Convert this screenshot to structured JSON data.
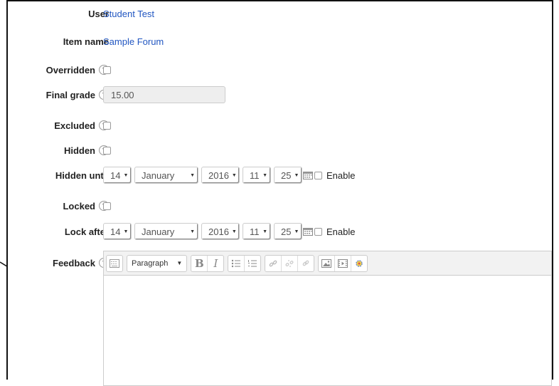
{
  "form": {
    "user": {
      "label": "User",
      "value": "Student Test"
    },
    "item_name": {
      "label": "Item name",
      "value": "Sample Forum"
    },
    "overridden": {
      "label": "Overridden"
    },
    "final_grade": {
      "label": "Final grade",
      "value": "15.00"
    },
    "excluded": {
      "label": "Excluded"
    },
    "hidden": {
      "label": "Hidden"
    },
    "hidden_until": {
      "label": "Hidden until",
      "day": "14",
      "month": "January",
      "year": "2016",
      "hour": "11",
      "minute": "25",
      "enable_label": "Enable"
    },
    "locked": {
      "label": "Locked"
    },
    "lock_after": {
      "label": "Lock after",
      "day": "14",
      "month": "January",
      "year": "2016",
      "hour": "11",
      "minute": "25",
      "enable_label": "Enable"
    },
    "feedback": {
      "label": "Feedback",
      "format": "Paragraph",
      "bold": "B",
      "italic": "I"
    }
  },
  "colors": {
    "link": "#2156c1",
    "readonly_bg": "#eeeeee",
    "toolbar_bg": "#f2f2f2"
  },
  "icons": [
    "help-icon",
    "calendar-icon",
    "toolbar-toggle-icon",
    "bullet-list-icon",
    "numbered-list-icon",
    "link-icon",
    "unlink-icon",
    "anchor-icon",
    "image-icon",
    "media-icon",
    "special-icon",
    "arrow-annotation-icon"
  ]
}
